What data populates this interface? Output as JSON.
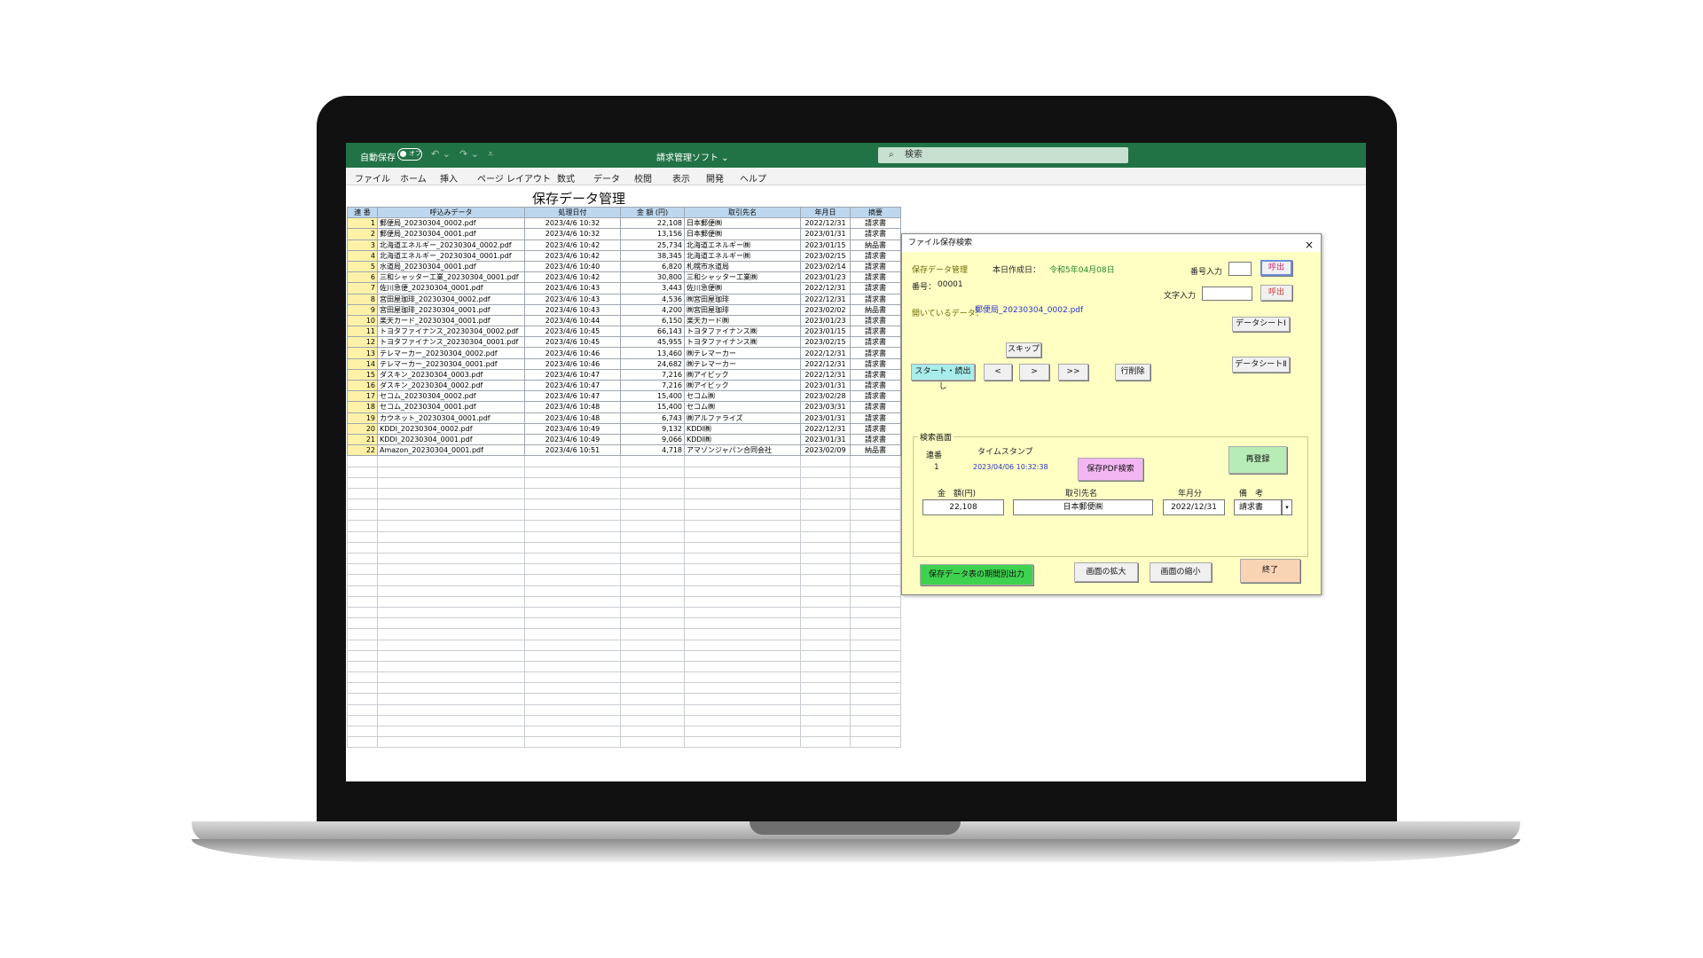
{
  "excel": {
    "autosave": "自動保存",
    "autosave_state": "オフ",
    "doc_title": "請求管理ソフト ⌄",
    "search_placeholder": "検索",
    "menu": [
      "ファイル",
      "ホーム",
      "挿入",
      "ページ レイアウト",
      "数式",
      "データ",
      "校閲",
      "表示",
      "開発",
      "ヘルプ"
    ]
  },
  "sheet": {
    "title": "保存データ管理",
    "headers": [
      "連 番",
      "呼込みデータ",
      "処理日付",
      "金 額 (円)",
      "取引先名",
      "年月日",
      "摘要"
    ],
    "rows": [
      [
        "1",
        "郵便局_20230304_0002.pdf",
        "2023/4/6 10:32",
        "22,108",
        "日本郵便㈱",
        "2022/12/31",
        "請求書"
      ],
      [
        "2",
        "郵便局_20230304_0001.pdf",
        "2023/4/6 10:32",
        "13,156",
        "日本郵便㈱",
        "2023/01/31",
        "請求書"
      ],
      [
        "3",
        "北海道エネルギー_20230304_0002.pdf",
        "2023/4/6 10:42",
        "25,734",
        "北海道エネルギー㈱",
        "2023/01/15",
        "納品書"
      ],
      [
        "4",
        "北海道エネルギー_20230304_0001.pdf",
        "2023/4/6 10:42",
        "38,345",
        "北海道エネルギー㈱",
        "2023/02/15",
        "請求書"
      ],
      [
        "5",
        "水道局_20230304_0001.pdf",
        "2023/4/6 10:40",
        "6,820",
        "札幌市水道局",
        "2023/02/14",
        "請求書"
      ],
      [
        "6",
        "三和シャッター工業_20230304_0001.pdf",
        "2023/4/6 10:42",
        "30,800",
        "三和シャッター工業㈱",
        "2023/01/23",
        "請求書"
      ],
      [
        "7",
        "佐川急便_20230304_0001.pdf",
        "2023/4/6 10:43",
        "3,443",
        "佐川急便㈱",
        "2022/12/31",
        "請求書"
      ],
      [
        "8",
        "宮田屋珈琲_20230304_0002.pdf",
        "2023/4/6 10:43",
        "4,536",
        "㈱宮田屋珈琲",
        "2022/12/31",
        "請求書"
      ],
      [
        "9",
        "宮田屋珈琲_20230304_0001.pdf",
        "2023/4/6 10:43",
        "4,200",
        "㈱宮田屋珈琲",
        "2023/02/02",
        "納品書"
      ],
      [
        "10",
        "楽天カード_20230304_0001.pdf",
        "2023/4/6 10:44",
        "6,150",
        "楽天カード㈱",
        "2023/01/23",
        "請求書"
      ],
      [
        "11",
        "トヨタファイナンス_20230304_0002.pdf",
        "2023/4/6 10:45",
        "66,143",
        "トヨタファイナンス㈱",
        "2023/01/15",
        "請求書"
      ],
      [
        "12",
        "トヨタファイナンス_20230304_0001.pdf",
        "2023/4/6 10:45",
        "45,955",
        "トヨタファイナンス㈱",
        "2023/02/15",
        "請求書"
      ],
      [
        "13",
        "テレマーカー_20230304_0002.pdf",
        "2023/4/6 10:46",
        "13,460",
        "㈱テレマーカー",
        "2022/12/31",
        "請求書"
      ],
      [
        "14",
        "テレマーカー_20230304_0001.pdf",
        "2023/4/6 10:46",
        "24,682",
        "㈱テレマーカー",
        "2022/12/31",
        "請求書"
      ],
      [
        "15",
        "ダスキン_20230304_0003.pdf",
        "2023/4/6 10:47",
        "7,216",
        "㈱アイビック",
        "2022/12/31",
        "請求書"
      ],
      [
        "16",
        "ダスキン_20230304_0002.pdf",
        "2023/4/6 10:47",
        "7,216",
        "㈱アイビック",
        "2023/01/31",
        "請求書"
      ],
      [
        "17",
        "セコム_20230304_0002.pdf",
        "2023/4/6 10:47",
        "15,400",
        "セコム㈱",
        "2023/02/28",
        "請求書"
      ],
      [
        "18",
        "セコム_20230304_0001.pdf",
        "2023/4/6 10:48",
        "15,400",
        "セコム㈱",
        "2023/03/31",
        "請求書"
      ],
      [
        "19",
        "カウネット_20230304_0001.pdf",
        "2023/4/6 10:48",
        "6,743",
        "㈱アルファライズ",
        "2023/01/31",
        "請求書"
      ],
      [
        "20",
        "KDDI_20230304_0002.pdf",
        "2023/4/6 10:49",
        "9,132",
        "KDDI㈱",
        "2022/12/31",
        "請求書"
      ],
      [
        "21",
        "KDDI_20230304_0001.pdf",
        "2023/4/6 10:49",
        "9,066",
        "KDDI㈱",
        "2023/01/31",
        "請求書"
      ],
      [
        "22",
        "Amazon_20230304_0001.pdf",
        "2023/4/6 10:51",
        "4,718",
        "アマゾンジャパン合同会社",
        "2023/02/09",
        "納品書"
      ]
    ]
  },
  "dialog": {
    "title": "ファイル保存検索",
    "close": "×",
    "app_name": "保存データ管理",
    "date_label": "本日作成日：",
    "date_value": "令和5年04月08日",
    "number_label": "番号：",
    "number_value": "00001",
    "number_input_label": "番号入力",
    "call_button": "呼出",
    "text_input_label": "文字入力",
    "call_button2": "呼出",
    "open_data_label": "開いているデータ：",
    "open_data_value": "郵便局_20230304_0002.pdf",
    "datasheet1": "データシートⅠ",
    "datasheet2": "データシートⅡ",
    "skip": "スキップ",
    "start": "スタート・読出し",
    "prev": "<",
    "next": ">",
    "last": ">>",
    "delete_row": "行削除",
    "search_frame": "検索画面",
    "serial_label": "連番",
    "serial_value": "1",
    "timestamp_label": "タイムスタンプ",
    "timestamp_value": "2023/04/06 10:32:38",
    "pdf_search": "保存PDF検索",
    "reregister": "再登録",
    "amount_label": "金　額(円)",
    "amount_value": "22,108",
    "partner_label": "取引先名",
    "partner_value": "日本郵便㈱",
    "month_label": "年月分",
    "month_value": "2022/12/31",
    "note_label": "備　考",
    "note_value": "請求書",
    "export": "保存データ表の期間別出力",
    "zoom_in": "画面の拡大",
    "zoom_out": "画面の縮小",
    "exit": "終了"
  }
}
